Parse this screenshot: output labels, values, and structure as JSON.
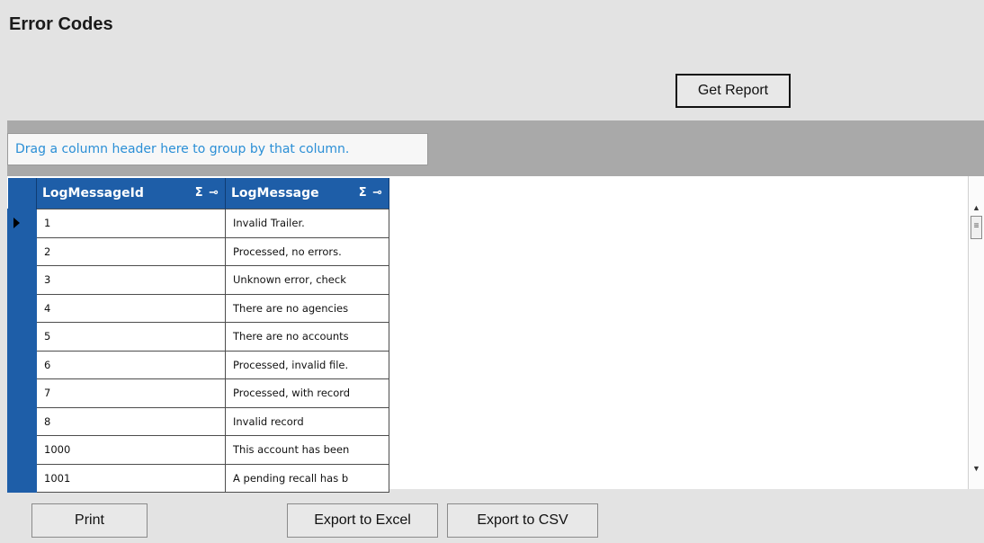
{
  "page": {
    "title": "Error Codes"
  },
  "toolbar": {
    "get_report_label": "Get Report"
  },
  "grid": {
    "group_panel_text": "Drag a column header here to group by that column.",
    "columns": [
      {
        "label": "LogMessageId",
        "icons": "Σ ⊸"
      },
      {
        "label": "LogMessage",
        "icons": "Σ ⊸"
      }
    ],
    "rows": [
      {
        "id": "1",
        "message": "Invalid Trailer."
      },
      {
        "id": "2",
        "message": "Processed, no errors."
      },
      {
        "id": "3",
        "message": "Unknown error, check"
      },
      {
        "id": "4",
        "message": "There are no agencies"
      },
      {
        "id": "5",
        "message": "There are no accounts"
      },
      {
        "id": "6",
        "message": "Processed, invalid file."
      },
      {
        "id": "7",
        "message": "Processed, with record"
      },
      {
        "id": "8",
        "message": "Invalid record"
      },
      {
        "id": "1000",
        "message": "This account has been"
      },
      {
        "id": "1001",
        "message": "A pending recall has b"
      }
    ],
    "selected_row_index": 0
  },
  "footer": {
    "print_label": "Print",
    "export_excel_label": "Export to Excel",
    "export_csv_label": "Export to CSV"
  },
  "colors": {
    "header_blue": "#1e5ea8",
    "group_text": "#2b8fd6",
    "grid_bg": "#a9a9a9"
  },
  "icons": {
    "row_pointer": "row-pointer-icon",
    "sum": "sum-icon",
    "pin": "pin-icon"
  }
}
